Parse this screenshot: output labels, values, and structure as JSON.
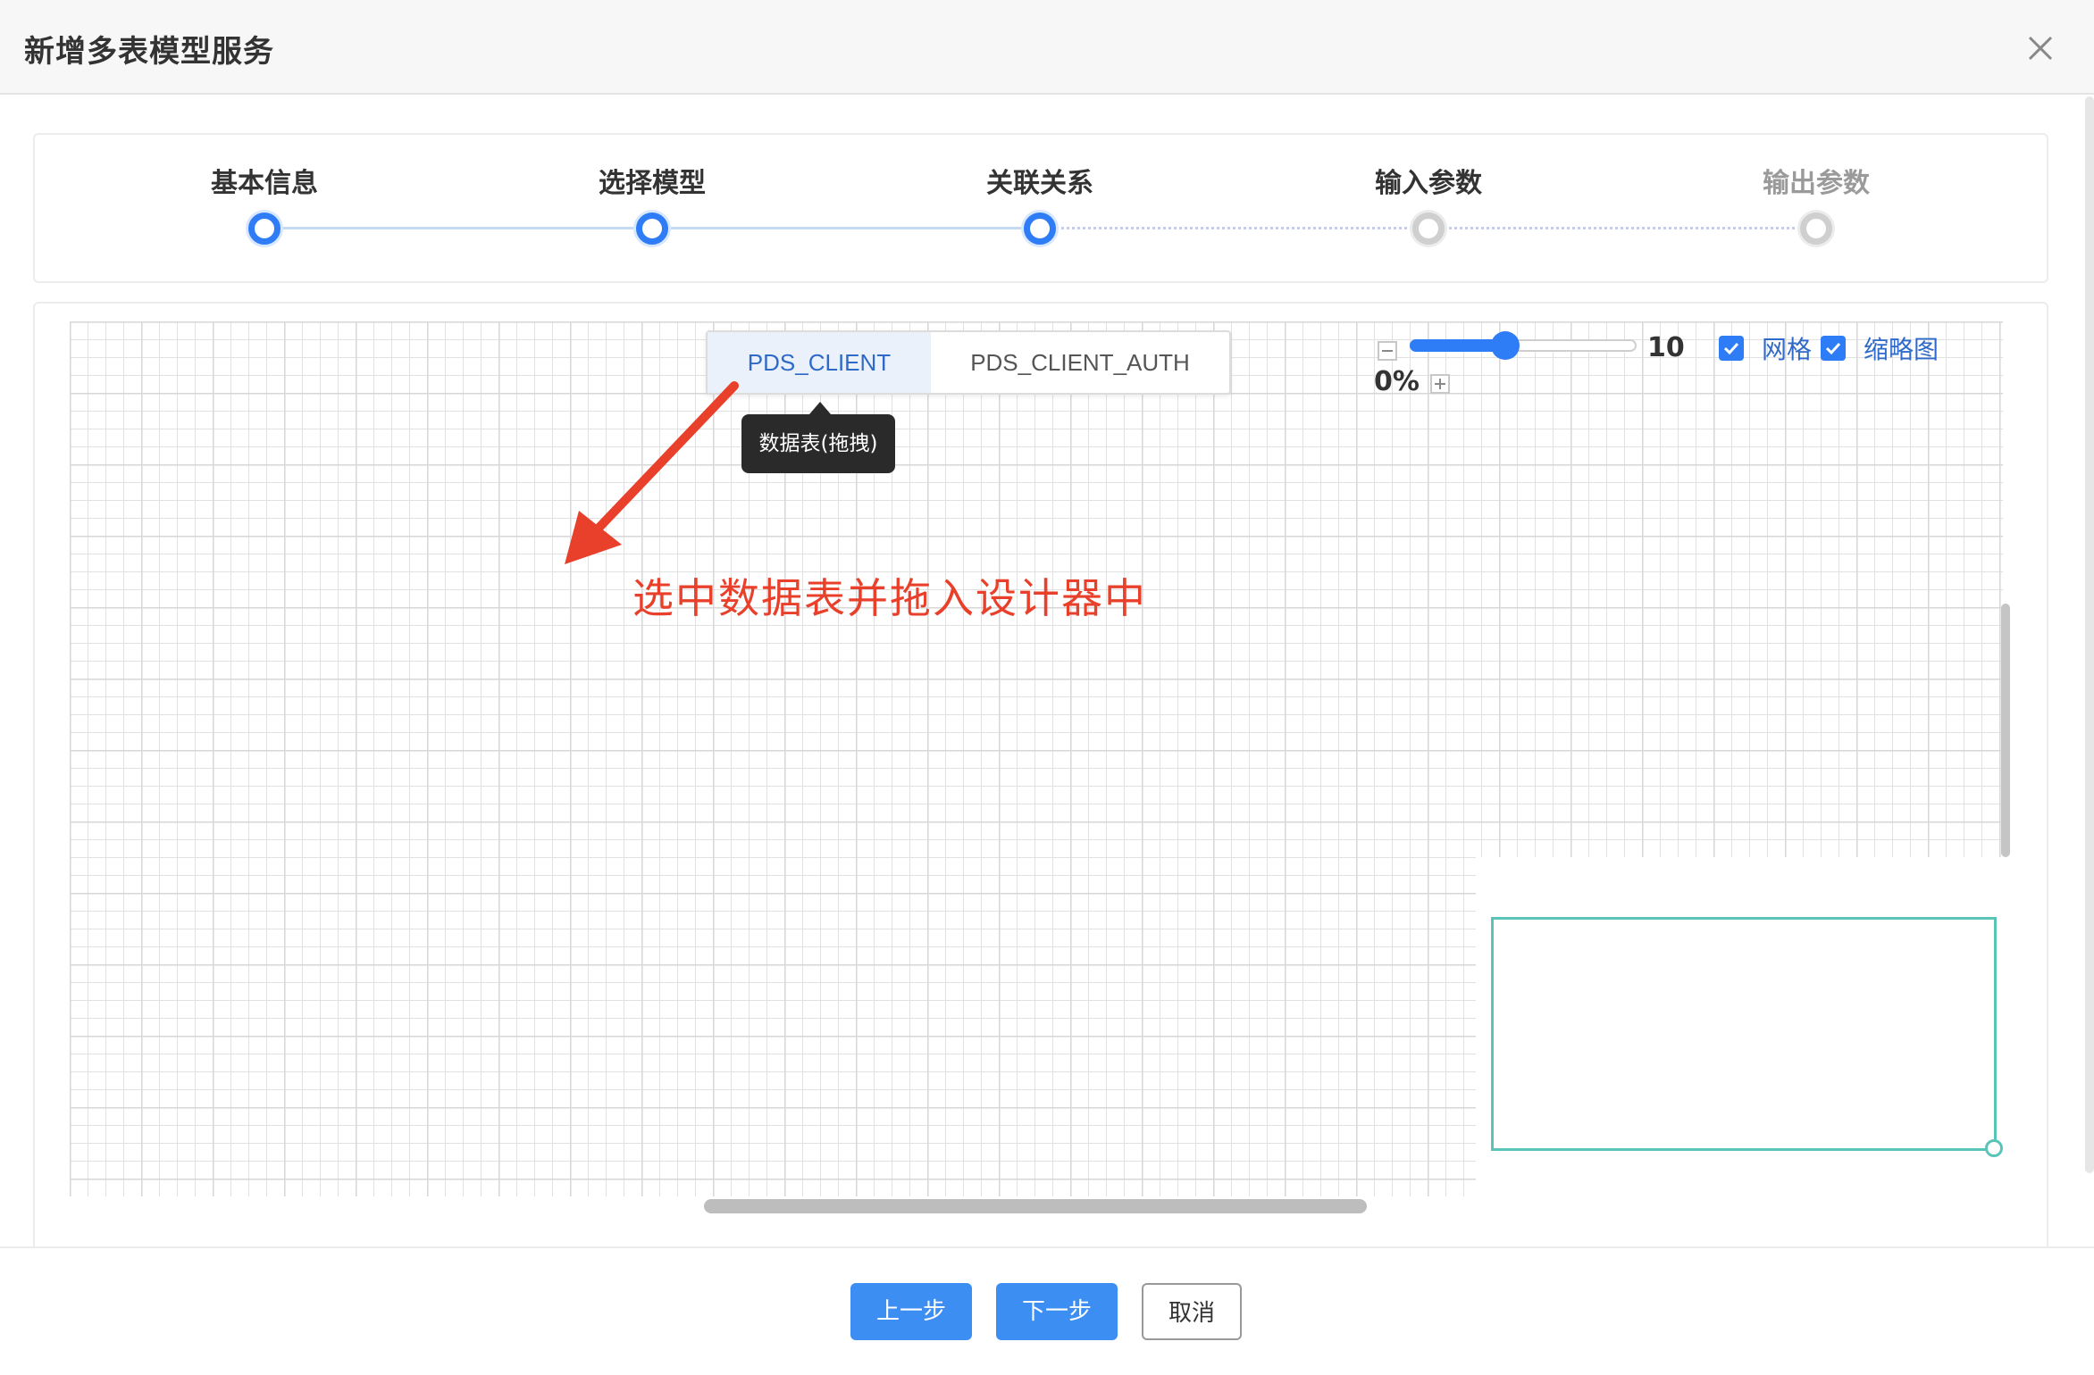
{
  "dialog": {
    "title": "新增多表模型服务"
  },
  "steps": [
    {
      "label": "基本信息",
      "state": "done"
    },
    {
      "label": "选择模型",
      "state": "done"
    },
    {
      "label": "关联关系",
      "state": "current"
    },
    {
      "label": "输入参数",
      "state": "todo"
    },
    {
      "label": "输出参数",
      "state": "todo"
    }
  ],
  "tables": {
    "tabs": [
      "PDS_CLIENT",
      "PDS_CLIENT_AUTH"
    ],
    "selected": "PDS_CLIENT"
  },
  "tooltip": {
    "text": "数据表(拖拽)"
  },
  "annotation": {
    "text": "选中数据表并拖入设计器中"
  },
  "toolbar": {
    "zoom_text_1": "10",
    "zoom_text_2": "0%",
    "zoom_fraction": 0.42,
    "grid_label": "网格",
    "grid_checked": true,
    "minimap_label": "缩略图",
    "minimap_checked": true
  },
  "footer": {
    "prev_label": "上一步",
    "next_label": "下一步",
    "cancel_label": "取消"
  },
  "colors": {
    "primary": "#2f7df6",
    "annotation": "#e8402b",
    "minimap": "#5bc4b8"
  }
}
